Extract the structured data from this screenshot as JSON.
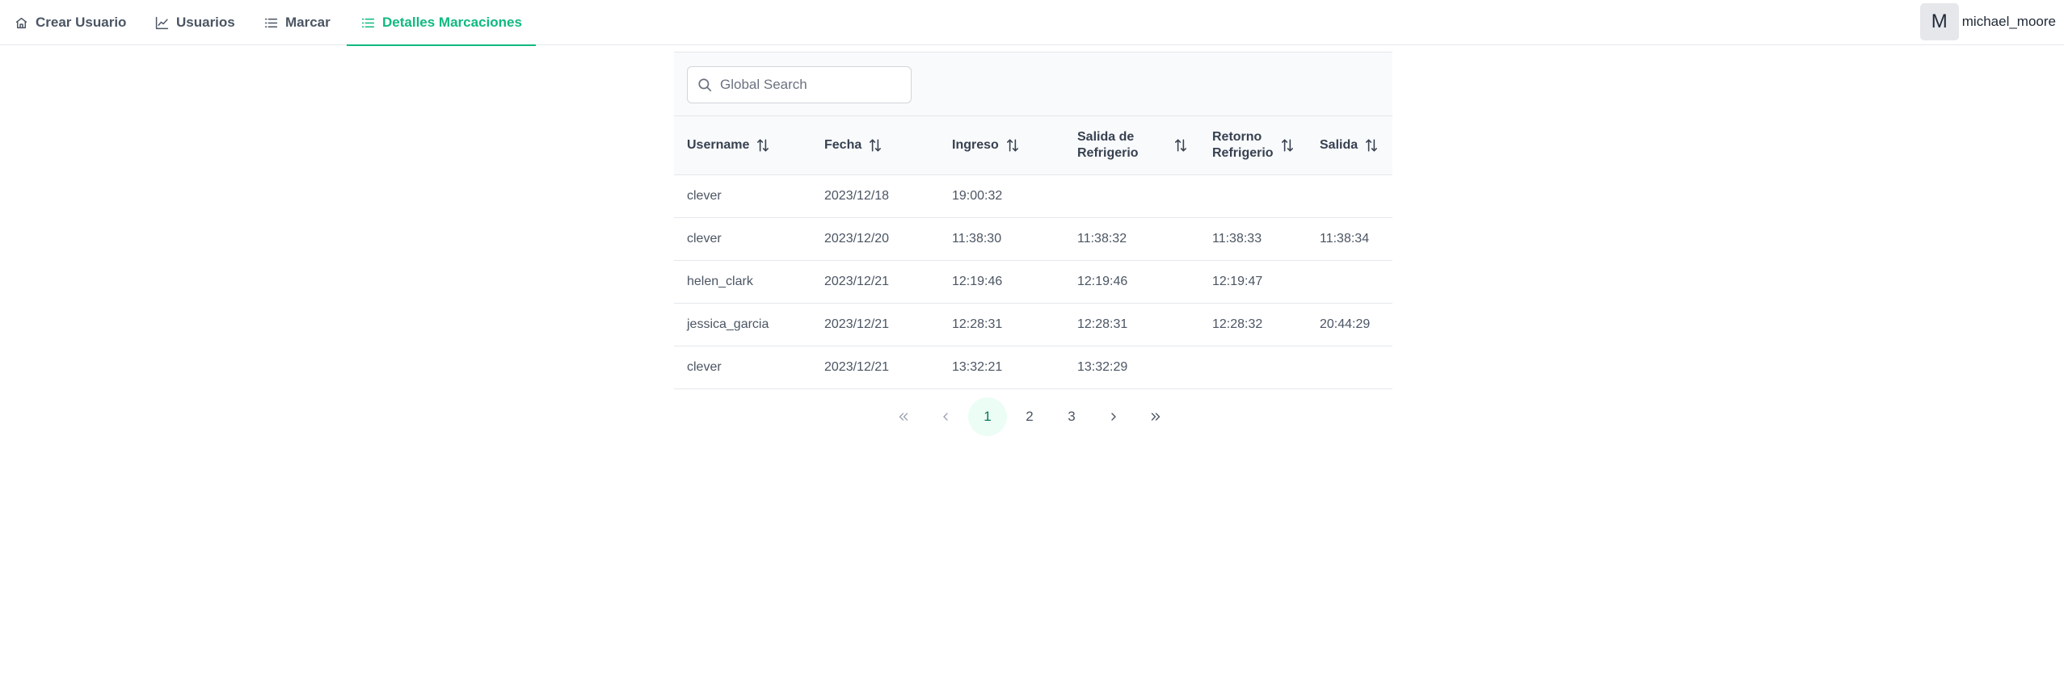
{
  "menubar": {
    "items": [
      {
        "label": "Crear Usuario",
        "icon": "home-icon",
        "active": false
      },
      {
        "label": "Usuarios",
        "icon": "chart-line-icon",
        "active": false
      },
      {
        "label": "Marcar",
        "icon": "list-icon",
        "active": false
      },
      {
        "label": "Detalles Marcaciones",
        "icon": "list-icon",
        "active": true
      }
    ],
    "avatar_letter": "M",
    "username": "michael_moore",
    "accent_color": "#10b981"
  },
  "table": {
    "search": {
      "placeholder": "Global Search",
      "value": ""
    },
    "columns": [
      {
        "line1": "Username",
        "line2": ""
      },
      {
        "line1": "Fecha",
        "line2": ""
      },
      {
        "line1": "Ingreso",
        "line2": ""
      },
      {
        "line1": "Salida de",
        "line2": "Refrigerio"
      },
      {
        "line1": "Retorno",
        "line2": "Refrigerio"
      },
      {
        "line1": "Salida",
        "line2": ""
      }
    ],
    "rows": [
      [
        "clever",
        "2023/12/18",
        "19:00:32",
        "",
        "",
        ""
      ],
      [
        "clever",
        "2023/12/20",
        "11:38:30",
        "11:38:32",
        "11:38:33",
        "11:38:34"
      ],
      [
        "helen_clark",
        "2023/12/21",
        "12:19:46",
        "12:19:46",
        "12:19:47",
        ""
      ],
      [
        "jessica_garcia",
        "2023/12/21",
        "12:28:31",
        "12:28:31",
        "12:28:32",
        "20:44:29"
      ],
      [
        "clever",
        "2023/12/21",
        "13:32:21",
        "13:32:29",
        "",
        ""
      ]
    ]
  },
  "paginator": {
    "pages": [
      "1",
      "2",
      "3"
    ],
    "current": "1"
  }
}
